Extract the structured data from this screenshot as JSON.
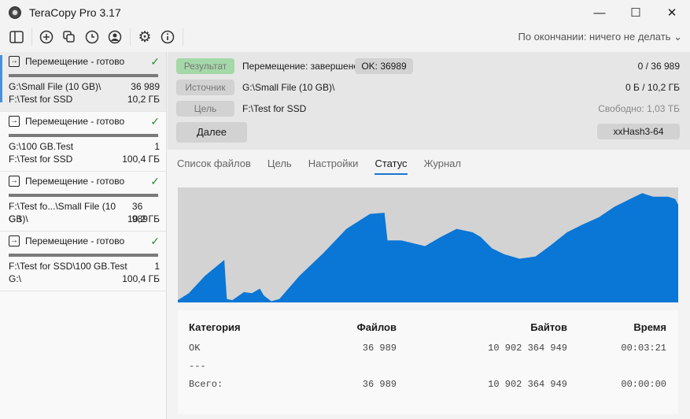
{
  "window": {
    "title": "TeraCopy Pro 3.17"
  },
  "toolbar": {
    "after_label": "По окончании: ничего не делать"
  },
  "jobs": [
    {
      "status": "Перемещение - готово",
      "source": "G:\\Small File (10 GB)\\",
      "count": "36 989",
      "target": "F:\\Test for SSD",
      "size": "10,2 ГБ"
    },
    {
      "status": "Перемещение - готово",
      "source": "G:\\100 GB.Test",
      "count": "1",
      "target": "F:\\Test for SSD",
      "size": "100,4 ГБ"
    },
    {
      "status": "Перемещение - готово",
      "source": "F:\\Test fo...\\Small File (10 GB)\\",
      "count": "36 989",
      "target": "G:\\",
      "size": "10,2 ГБ"
    },
    {
      "status": "Перемещение - готово",
      "source": "F:\\Test for SSD\\100 GB.Test",
      "count": "1",
      "target": "G:\\",
      "size": "100,4 ГБ"
    }
  ],
  "info": {
    "result_label": "Результат",
    "result_text": "Перемещение: завершено",
    "ok_badge": "OK: 36989",
    "files_progress": "0 / 36 989",
    "source_label": "Источник",
    "source_text": "G:\\Small File (10 GB)\\",
    "bytes_progress": "0 Б / 10,2 ГБ",
    "target_label": "Цель",
    "target_text": "F:\\Test for SSD",
    "free_space": "Свободно: 1,03 ТБ",
    "next_button": "Далее",
    "hash_button": "xxHash3-64"
  },
  "tabs": [
    "Список файлов",
    "Цель",
    "Настройки",
    "Статус",
    "Журнал"
  ],
  "speed_graph": [
    [
      0,
      0.02
    ],
    [
      0.022,
      0.08
    ],
    [
      0.054,
      0.23
    ],
    [
      0.093,
      0.37
    ],
    [
      0.098,
      0.03
    ],
    [
      0.109,
      0.02
    ],
    [
      0.132,
      0.09
    ],
    [
      0.148,
      0.08
    ],
    [
      0.164,
      0.12
    ],
    [
      0.172,
      0.06
    ],
    [
      0.187,
      0.01
    ],
    [
      0.203,
      0.03
    ],
    [
      0.243,
      0.23
    ],
    [
      0.291,
      0.43
    ],
    [
      0.337,
      0.64
    ],
    [
      0.384,
      0.77
    ],
    [
      0.413,
      0.78
    ],
    [
      0.419,
      0.54
    ],
    [
      0.447,
      0.54
    ],
    [
      0.494,
      0.49
    ],
    [
      0.526,
      0.57
    ],
    [
      0.557,
      0.64
    ],
    [
      0.589,
      0.61
    ],
    [
      0.605,
      0.57
    ],
    [
      0.628,
      0.47
    ],
    [
      0.652,
      0.42
    ],
    [
      0.683,
      0.38
    ],
    [
      0.715,
      0.4
    ],
    [
      0.746,
      0.5
    ],
    [
      0.778,
      0.61
    ],
    [
      0.81,
      0.68
    ],
    [
      0.841,
      0.74
    ],
    [
      0.872,
      0.83
    ],
    [
      0.904,
      0.9
    ],
    [
      0.928,
      0.95
    ],
    [
      0.95,
      0.92
    ],
    [
      0.98,
      0.92
    ],
    [
      0.994,
      0.9
    ],
    [
      1,
      0.85
    ]
  ],
  "stats": {
    "headers": [
      "Категория",
      "Файлов",
      "Байтов",
      "Время"
    ],
    "rows": [
      [
        "OK",
        "36 989",
        "10 902 364 949",
        "00:03:21"
      ],
      [
        "---",
        "",
        "",
        ""
      ],
      [
        "Всего:",
        "36 989",
        "10 902 364 949",
        "00:00:00"
      ]
    ]
  }
}
